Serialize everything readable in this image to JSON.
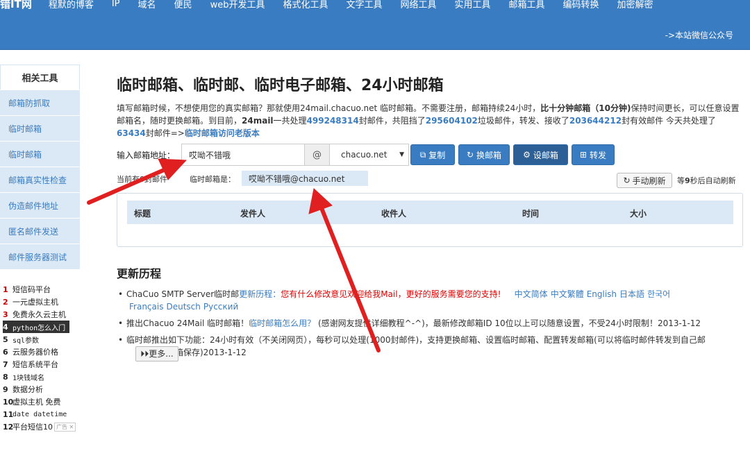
{
  "nav": {
    "logo": "错IT网",
    "items": [
      "程默的博客",
      "IP",
      "域名",
      "便民",
      "web开发工具",
      "格式化工具",
      "文字工具",
      "网络工具",
      "实用工具",
      "邮箱工具",
      "编码转换",
      "加密解密"
    ],
    "wechat_link": "->本站微信公众号"
  },
  "sidebar": {
    "title": "相关工具",
    "items": [
      "邮箱防抓取",
      "临时邮箱",
      "临时邮箱",
      "邮箱真实性检查",
      "伪造邮件地址",
      "匿名邮件发送",
      "邮件服务器测试"
    ]
  },
  "hot_list": [
    {
      "num": "1",
      "text": "短信码平台"
    },
    {
      "num": "2",
      "text": "一元虚拟主机"
    },
    {
      "num": "3",
      "text": "免费永久云主机"
    },
    {
      "num": "4",
      "text": "python怎么入门"
    },
    {
      "num": "5",
      "text": "sql参数"
    },
    {
      "num": "6",
      "text": "云服务器价格"
    },
    {
      "num": "7",
      "text": "短信系统平台"
    },
    {
      "num": "8",
      "text": "1块钱域名"
    },
    {
      "num": "9",
      "text": "数据分析"
    },
    {
      "num": "10",
      "text": "虚拟主机 免费"
    },
    {
      "num": "11",
      "text": "date datetime"
    },
    {
      "num": "12",
      "text": "平台短信10"
    }
  ],
  "ad_badge": "广告 ✕",
  "main": {
    "title": "临时邮箱、临时邮、临时电子邮箱、24小时邮箱",
    "desc": {
      "p1": "填写邮箱时候，不想使用您的真实邮箱？那就使用24mail.chacuo.net 临时邮箱。不需要注册，邮箱持续24小时，",
      "b1": "比十分钟邮箱（10分钟)",
      "p2": "保持时间更长，可以任意设置邮箱名，随时更换邮箱。到目前，",
      "b2": "24mail",
      "p3": "一共处理",
      "n1": "499248314",
      "p4": "封邮件，共阻挡了",
      "n2": "295604102",
      "p5": "垃圾邮件，转发、接收了",
      "n3": "203644212",
      "p6": "封有效邮件 今天共处理了",
      "n4": "63434",
      "p7": "封邮件=>",
      "old_link": "临时邮箱访问老版本"
    },
    "input_label": "输入邮箱地址：",
    "address_value": "哎呦不错哦",
    "at": "@",
    "domain": "chacuo.net",
    "buttons": {
      "copy": "复制",
      "change": "换邮箱",
      "set": "设邮箱",
      "forward": "转发"
    },
    "current_label": "当前有0封邮件",
    "tmp_label": "临时邮箱是：",
    "tmp_address": "哎呦不错哦@chacuo.net",
    "refresh_button": "手动刷新",
    "auto_refresh": {
      "pre": "等",
      "sec": "9",
      "post": "秒后自动刷新"
    },
    "table_headers": [
      "标题",
      "发件人",
      "收件人",
      "时间",
      "大小"
    ]
  },
  "history": {
    "title": "更新历程",
    "item1": {
      "pre": "ChaCuo SMTP Server临时邮",
      "link": "更新历程：",
      "red": "您有什么修改意见欢迎给我Mail，更好的服务需要您的支持!",
      "langs": [
        "中文简体",
        "中文繁體",
        "English",
        "日本語",
        "한국어",
        "Français",
        "Deutsch",
        "Русский"
      ]
    },
    "item2": {
      "pre": "推出Chacuo 24Mail 临时邮箱！",
      "link": "临时邮箱怎么用？",
      "post": "  (感谢网友提供详细教程^-^)，最新修改邮箱ID 10位以上可以随意设置，不受24小时限制！2013-1-12"
    },
    "item3": {
      "line1": "临时邮推出如下功能：24小时有效（不关闭网页），每秒可以处理(1000封邮件)，支持更换邮箱、设置临时邮箱、配置转发邮箱(可以将临时邮件转发到自己邮",
      "line2": "箱保存)2013-1-12"
    },
    "more_button": "更多..."
  },
  "colors": {
    "brand": "#3a7cc1",
    "arrow": "#e02020",
    "side_bg": "#dbe8f5"
  }
}
